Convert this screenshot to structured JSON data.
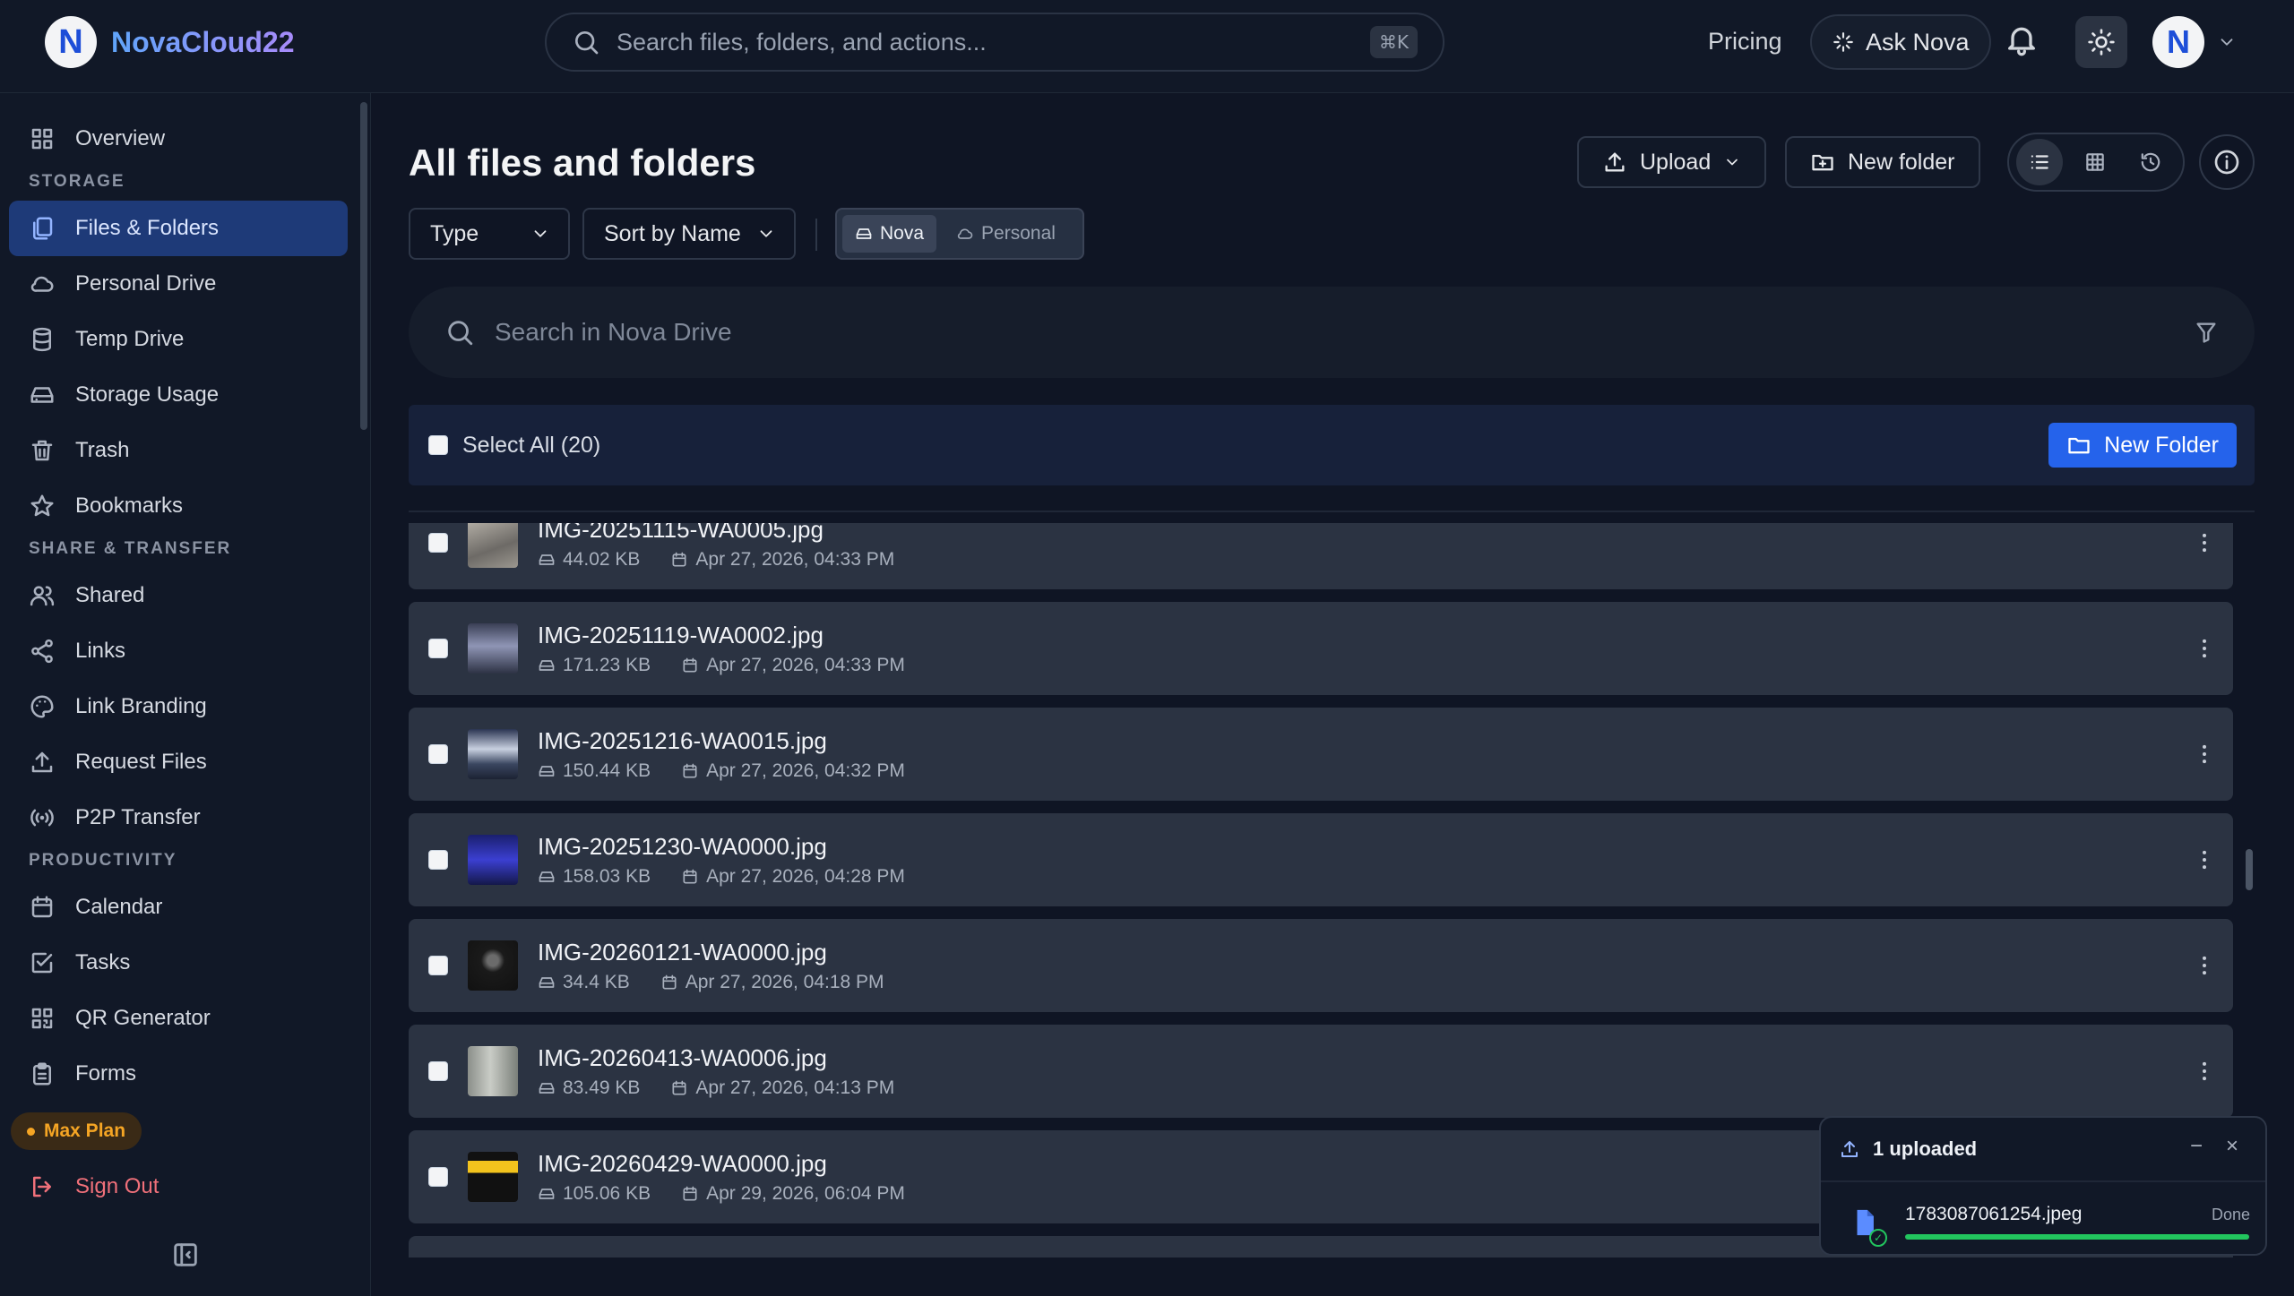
{
  "app": {
    "name": "NovaCloud22",
    "logo_letter": "N"
  },
  "search": {
    "placeholder": "Search files, folders, and actions...",
    "shortcut": "⌘K"
  },
  "header": {
    "pricing": "Pricing",
    "ask_nova": "Ask Nova"
  },
  "sidebar": {
    "overview": "Overview",
    "sections": [
      "STORAGE",
      "SHARE & TRANSFER",
      "PRODUCTIVITY"
    ],
    "storage": [
      "Files & Folders",
      "Personal Drive",
      "Temp Drive",
      "Storage Usage",
      "Trash",
      "Bookmarks"
    ],
    "share": [
      "Shared",
      "Links",
      "Link Branding",
      "Request Files",
      "P2P Transfer"
    ],
    "productivity": [
      "Calendar",
      "Tasks",
      "QR Generator",
      "Forms"
    ],
    "active_item": "Files & Folders",
    "plan": "Max Plan",
    "sign_out": "Sign Out"
  },
  "main": {
    "title": "All files and folders",
    "upload": "Upload",
    "new_folder": "New folder",
    "filters": {
      "type": "Type",
      "sort": "Sort by Name"
    },
    "sources": [
      "Nova",
      "Personal"
    ],
    "active_source": "Nova",
    "drive_search_placeholder": "Search in Nova Drive",
    "select_all": "Select All (20)",
    "new_folder_primary": "New Folder"
  },
  "files": [
    {
      "name": "IMG-20251115-WA0005.jpg",
      "size": "44.02 KB",
      "date": "Apr 27, 2026, 04:33 PM"
    },
    {
      "name": "IMG-20251119-WA0002.jpg",
      "size": "171.23 KB",
      "date": "Apr 27, 2026, 04:33 PM"
    },
    {
      "name": "IMG-20251216-WA0015.jpg",
      "size": "150.44 KB",
      "date": "Apr 27, 2026, 04:32 PM"
    },
    {
      "name": "IMG-20251230-WA0000.jpg",
      "size": "158.03 KB",
      "date": "Apr 27, 2026, 04:28 PM"
    },
    {
      "name": "IMG-20260121-WA0000.jpg",
      "size": "34.4 KB",
      "date": "Apr 27, 2026, 04:18 PM"
    },
    {
      "name": "IMG-20260413-WA0006.jpg",
      "size": "83.49 KB",
      "date": "Apr 27, 2026, 04:13 PM"
    },
    {
      "name": "IMG-20260429-WA0000.jpg",
      "size": "105.06 KB",
      "date": "Apr 29, 2026, 06:04 PM"
    }
  ],
  "upload_panel": {
    "title": "1 uploaded",
    "file": "1783087061254.jpeg",
    "status": "Done",
    "progress": 1.0
  },
  "colors": {
    "accent": "#2563eb",
    "active_nav": "#1e3a78",
    "plan": "#f5a524",
    "danger": "#f0707a",
    "success": "#22c55e"
  }
}
